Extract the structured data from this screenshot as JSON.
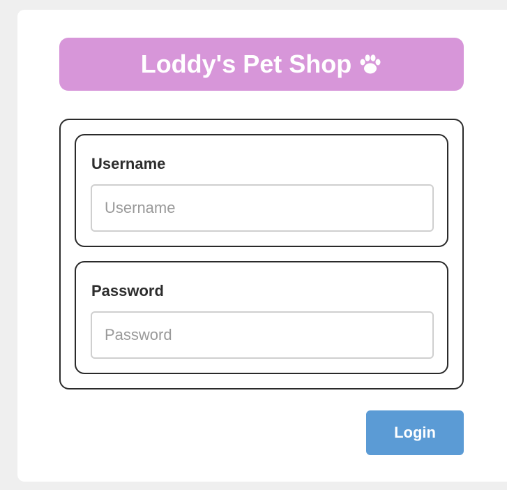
{
  "header": {
    "title": "Loddy's Pet Shop",
    "icon": "paw-icon"
  },
  "form": {
    "username": {
      "label": "Username",
      "placeholder": "Username",
      "value": ""
    },
    "password": {
      "label": "Password",
      "placeholder": "Password",
      "value": ""
    },
    "login_label": "Login"
  },
  "colors": {
    "banner": "#d796d9",
    "button": "#5b9bd5",
    "background": "#efefef",
    "card": "#ffffff"
  }
}
